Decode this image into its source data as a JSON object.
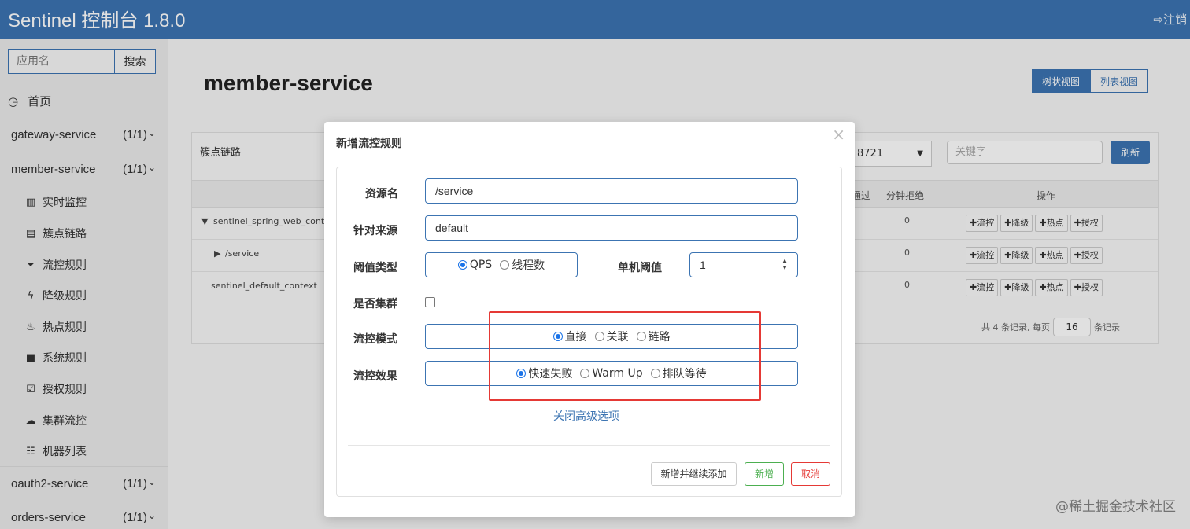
{
  "header": {
    "title": "Sentinel 控制台 1.8.0",
    "logout": "注销"
  },
  "sidebar": {
    "search_placeholder": "应用名",
    "search_button": "搜索",
    "home": "首页",
    "apps": [
      {
        "name": "gateway-service",
        "count": "(1/1)"
      },
      {
        "name": "member-service",
        "count": "(1/1)"
      },
      {
        "name": "oauth2-service",
        "count": "(1/1)"
      },
      {
        "name": "orders-service",
        "count": "(1/1)"
      }
    ],
    "menu": [
      {
        "label": "实时监控",
        "icon": "bar-chart-icon"
      },
      {
        "label": "簇点链路",
        "icon": "list-icon"
      },
      {
        "label": "流控规则",
        "icon": "filter-icon"
      },
      {
        "label": "降级规则",
        "icon": "flash-icon"
      },
      {
        "label": "热点规则",
        "icon": "fire-icon"
      },
      {
        "label": "系统规则",
        "icon": "lock-icon"
      },
      {
        "label": "授权规则",
        "icon": "check-square-icon"
      },
      {
        "label": "集群流控",
        "icon": "cloud-icon"
      },
      {
        "label": "机器列表",
        "icon": "th-list-icon"
      }
    ]
  },
  "main": {
    "page_title": "member-service",
    "view_tree": "树状视图",
    "view_list": "列表视图",
    "panel_title": "簇点链路",
    "machine_select": "8721",
    "keyword_placeholder": "关键字",
    "refresh": "刷新",
    "columns": {
      "pass": "通过",
      "block_min": "分钟拒绝",
      "ops": "操作"
    },
    "rows": [
      {
        "resource": "sentinel_spring_web_conte",
        "prefix": "▼",
        "block": "0"
      },
      {
        "resource": "/service",
        "prefix": "▶",
        "block": "0"
      },
      {
        "resource": "sentinel_default_context",
        "prefix": "",
        "block": "0"
      }
    ],
    "op_buttons": [
      "✚流控",
      "✚降级",
      "✚热点",
      "✚授权"
    ],
    "pager": {
      "prefix": "共 4 条记录, 每页",
      "page_size": "16",
      "suffix": "条记录"
    }
  },
  "modal": {
    "title": "新增流控规则",
    "close": "×",
    "resource_label": "资源名",
    "resource_value": "/service",
    "source_label": "针对来源",
    "source_value": "default",
    "threshold_type_label": "阈值类型",
    "threshold_types": [
      "QPS",
      "线程数"
    ],
    "threshold_selected": "QPS",
    "single_threshold_label": "单机阈值",
    "single_threshold_value": "1",
    "cluster_label": "是否集群",
    "cluster_checked": false,
    "mode_label": "流控模式",
    "modes": [
      "直接",
      "关联",
      "链路"
    ],
    "mode_selected": "直接",
    "effect_label": "流控效果",
    "effects": [
      "快速失败",
      "Warm Up",
      "排队等待"
    ],
    "effect_selected": "快速失败",
    "advanced_link": "关闭高级选项",
    "btn_add_continue": "新增并继续添加",
    "btn_add": "新增",
    "btn_cancel": "取消"
  },
  "watermark": "@稀土掘金技术社区",
  "colors": {
    "primary": "#3c74b2",
    "success": "#4caf50",
    "danger": "#e53935",
    "highlight_box": "#e53935"
  }
}
